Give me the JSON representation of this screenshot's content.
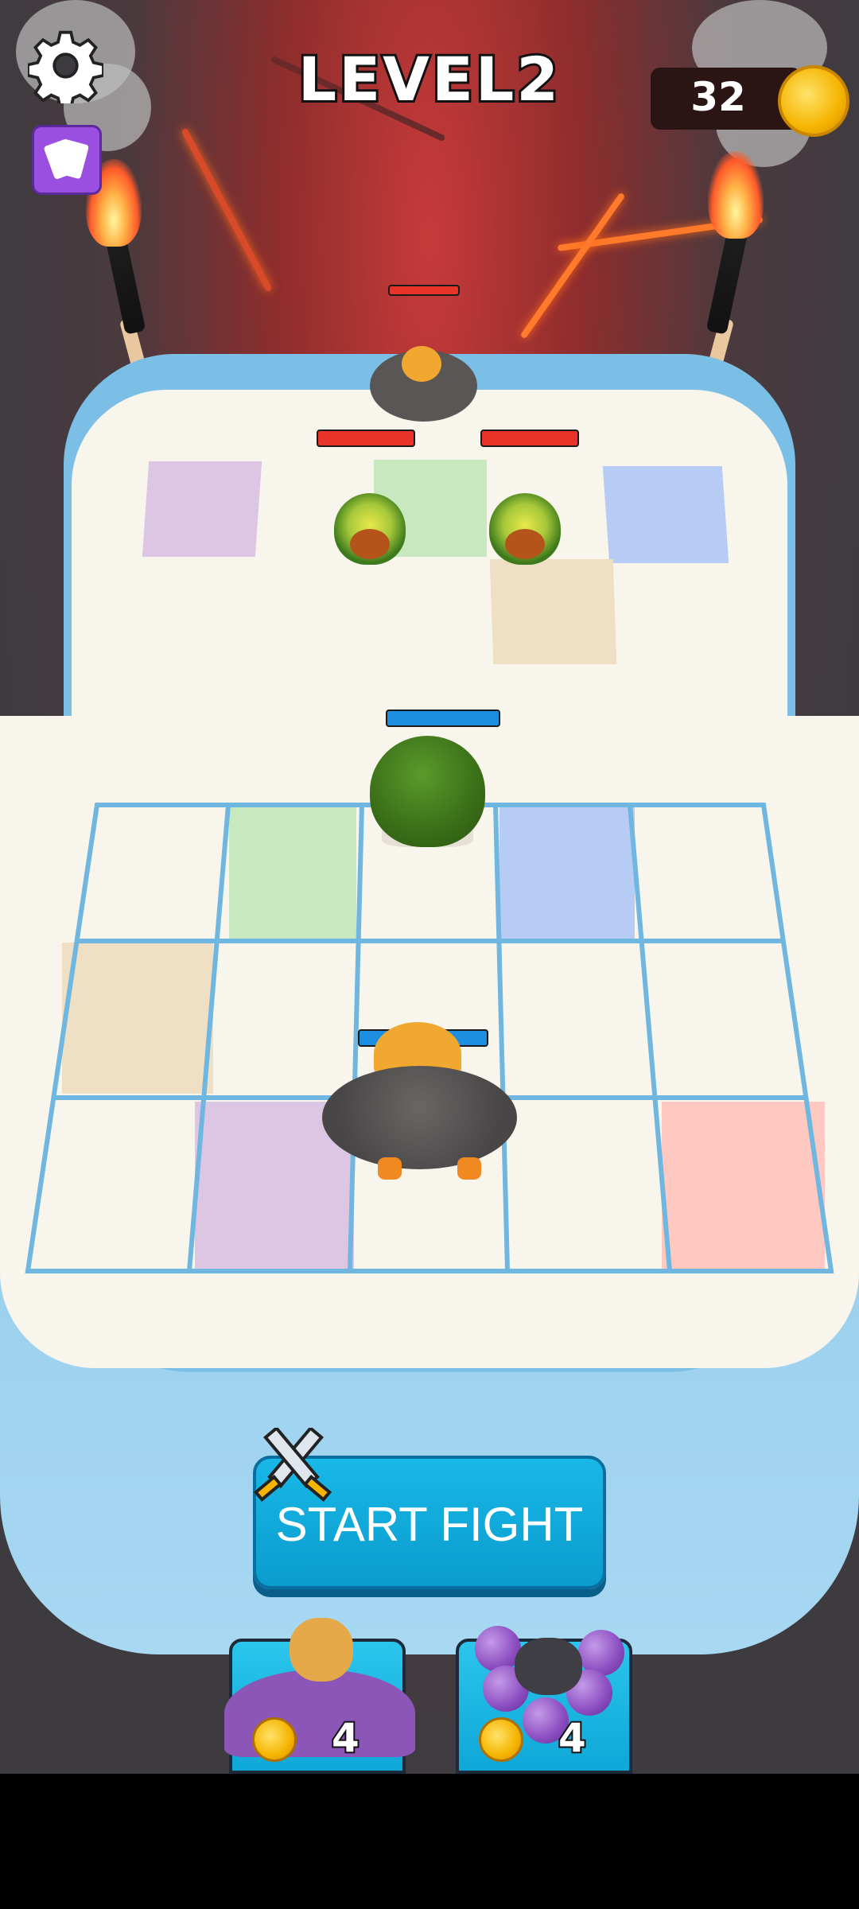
{
  "hud": {
    "level_title": "LEVEL2",
    "coin_count": "32",
    "settings_icon": "gear-icon",
    "cards_icon": "cards-icon",
    "coin_icon": "coin-icon"
  },
  "battle": {
    "start_fight_label": "START FIGHT",
    "start_fight_icon": "crossed-swords-icon"
  },
  "units_shop": [
    {
      "name_icon": "doge-brawler",
      "price": "4",
      "price_icon": "coin-icon"
    },
    {
      "name_icon": "grape-cat",
      "price": "4",
      "price_icon": "coin-icon"
    }
  ],
  "colors": {
    "enemy_hp": "#e8332a",
    "ally_hp": "#1e8fe0",
    "button": "#0fa8da",
    "grid_line": "#6fb6e0"
  }
}
